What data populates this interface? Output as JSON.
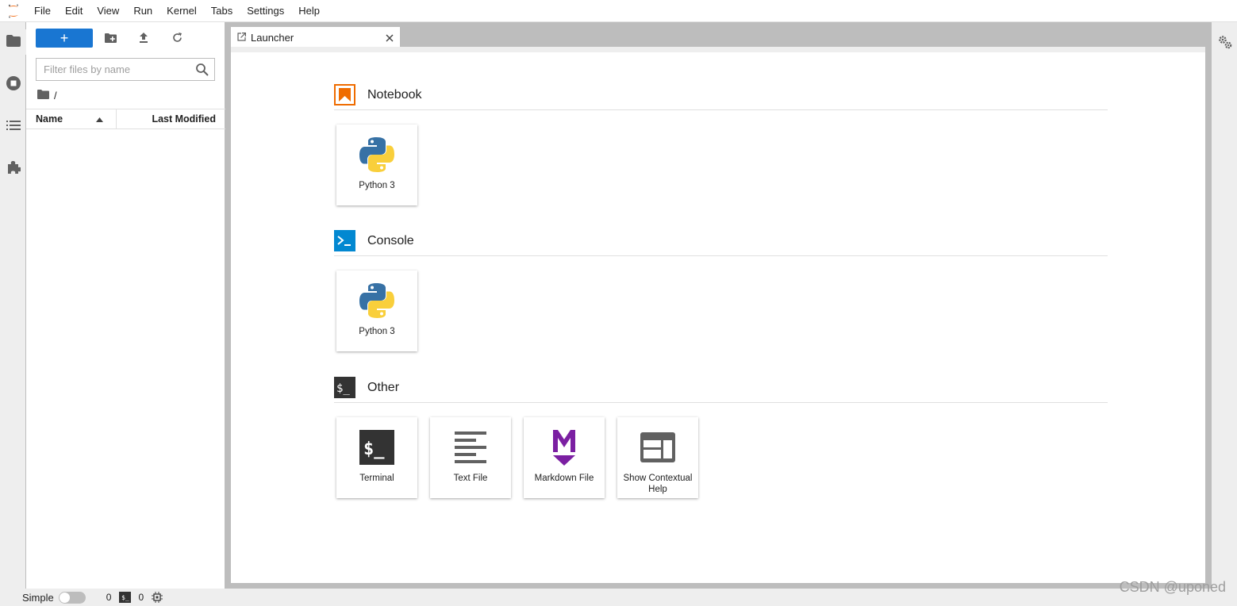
{
  "menubar": {
    "items": [
      "File",
      "Edit",
      "View",
      "Run",
      "Kernel",
      "Tabs",
      "Settings",
      "Help"
    ]
  },
  "filebrowser": {
    "new_button_label": "+",
    "filter_placeholder": "Filter files by name",
    "breadcrumb_path": "/",
    "columns": {
      "name": "Name",
      "last_modified": "Last Modified"
    }
  },
  "tabs": [
    {
      "label": "Launcher"
    }
  ],
  "launcher": {
    "sections": [
      {
        "title": "Notebook",
        "cards": [
          "Python 3"
        ]
      },
      {
        "title": "Console",
        "cards": [
          "Python 3"
        ]
      },
      {
        "title": "Other",
        "cards": [
          "Terminal",
          "Text File",
          "Markdown File",
          "Show Contextual Help"
        ]
      }
    ]
  },
  "statusbar": {
    "mode_label": "Simple",
    "terminals_count": "0",
    "terminal_icon_text": "$_",
    "kernels_count": "0"
  },
  "watermark": "CSDN @uponed",
  "colors": {
    "accent": "#1976d2",
    "notebook_icon": "#ef6c00",
    "console_icon": "#0288d1",
    "markdown_icon": "#7b1fa2"
  }
}
